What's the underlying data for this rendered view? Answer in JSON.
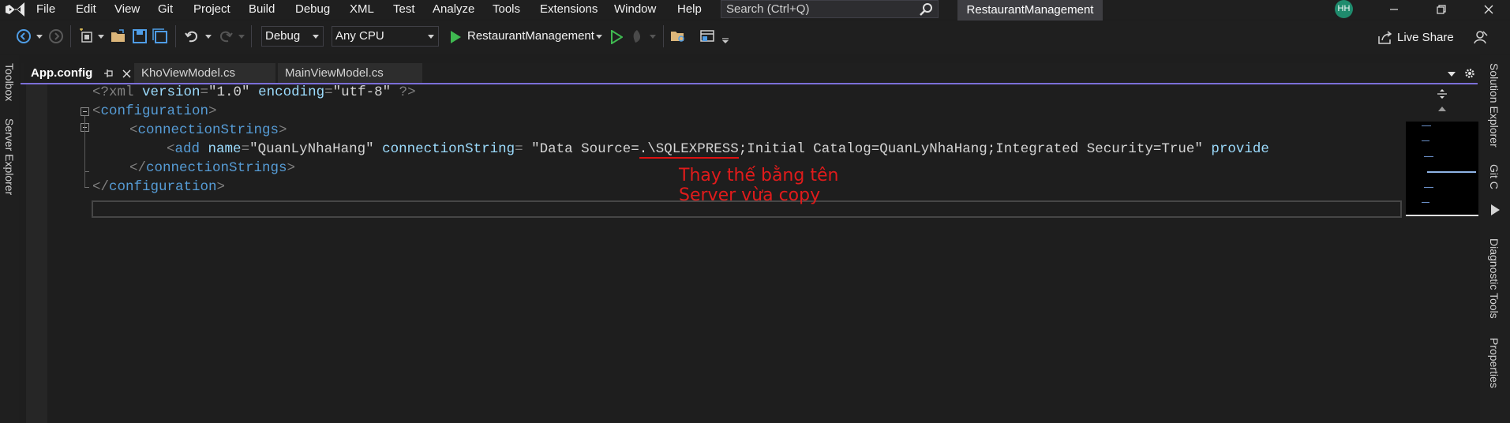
{
  "menu": {
    "items": [
      "File",
      "Edit",
      "View",
      "Git",
      "Project",
      "Build",
      "Debug",
      "XML",
      "Test",
      "Analyze",
      "Tools",
      "Extensions",
      "Window",
      "Help"
    ],
    "search_placeholder": "Search (Ctrl+Q)",
    "solution_name": "RestaurantManagement",
    "user_initials": "HH"
  },
  "toolbar": {
    "configuration": "Debug",
    "platform": "Any CPU",
    "startup_project": "RestaurantManagement",
    "live_share": "Live Share"
  },
  "left_rail": {
    "items": [
      "Toolbox",
      "Server Explorer"
    ]
  },
  "right_rail": {
    "items": [
      "Solution Explorer",
      "Git C",
      "Diagnostic Tools",
      "Properties"
    ]
  },
  "tabs": [
    {
      "label": "App.config",
      "active": true
    },
    {
      "label": "KhoViewModel.cs",
      "active": false
    },
    {
      "label": "MainViewModel.cs",
      "active": false
    }
  ],
  "code": {
    "line1": {
      "open": "<?xml ",
      "a1": "version",
      "eq1": "=",
      "v1": "\"1.0\"",
      "a2": "encoding",
      "eq2": "=",
      "v2": "\"utf-8\"",
      "close": " ?>"
    },
    "line2": {
      "lt": "<",
      "tag": "configuration",
      "gt": ">"
    },
    "line3": {
      "lt": "<",
      "tag": "connectionStrings",
      "gt": ">"
    },
    "line4": {
      "lt": "<",
      "tag": "add",
      "a1": "name",
      "eq1": "=",
      "v1": "\"QuanLyNhaHang\"",
      "a2": "connectionString",
      "eq2": "=",
      "v2_pre": " \"Data Source=",
      "v2_server": ".\\SQLEXPRESS",
      "v2_post": ";Initial Catalog=QuanLyNhaHang;Integrated Security=True\"",
      "a3": "provide"
    },
    "line5": {
      "lt": "</",
      "tag": "connectionStrings",
      "gt": ">"
    },
    "line6": {
      "lt": "</",
      "tag": "configuration",
      "gt": ">"
    }
  },
  "annotation": {
    "line1": "Thay thế bằng tên",
    "line2": "Server vừa copy"
  },
  "colors": {
    "accent": "#7b6fd8",
    "annotation": "#e01b1b",
    "tag": "#569cd6",
    "attribute": "#9cdcfe"
  }
}
